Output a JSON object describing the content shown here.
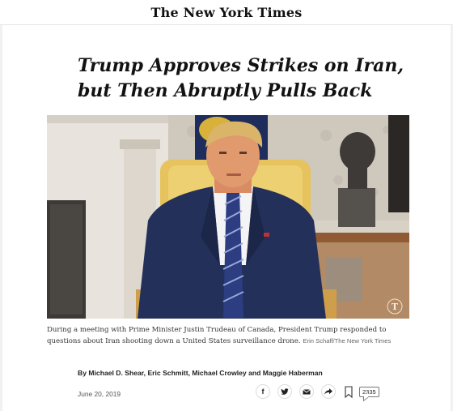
{
  "masthead": {
    "logo_text": "The New York Times"
  },
  "article": {
    "headline_line1": "Trump Approves Strikes on Iran,",
    "headline_line2": "but Then Abruptly Pulls Back",
    "caption": "During a meeting with Prime Minister Justin Trudeau of Canada, President Trump responded to questions about Iran shooting down a United States surveillance drone.",
    "caption_credit": "Erin Schaff/The New York Times",
    "byline": "By Michael D. Shear, Eric Schmitt, Michael Crowley and Maggie Haberman",
    "date": "June 20, 2019"
  },
  "share_bar": {
    "facebook_glyph": "f",
    "icons": [
      "facebook-icon",
      "twitter-icon",
      "email-icon",
      "share-arrow-icon",
      "bookmark-icon",
      "comment-icon"
    ],
    "comment_count": "2335"
  },
  "photo": {
    "watermark_letter": "T"
  }
}
